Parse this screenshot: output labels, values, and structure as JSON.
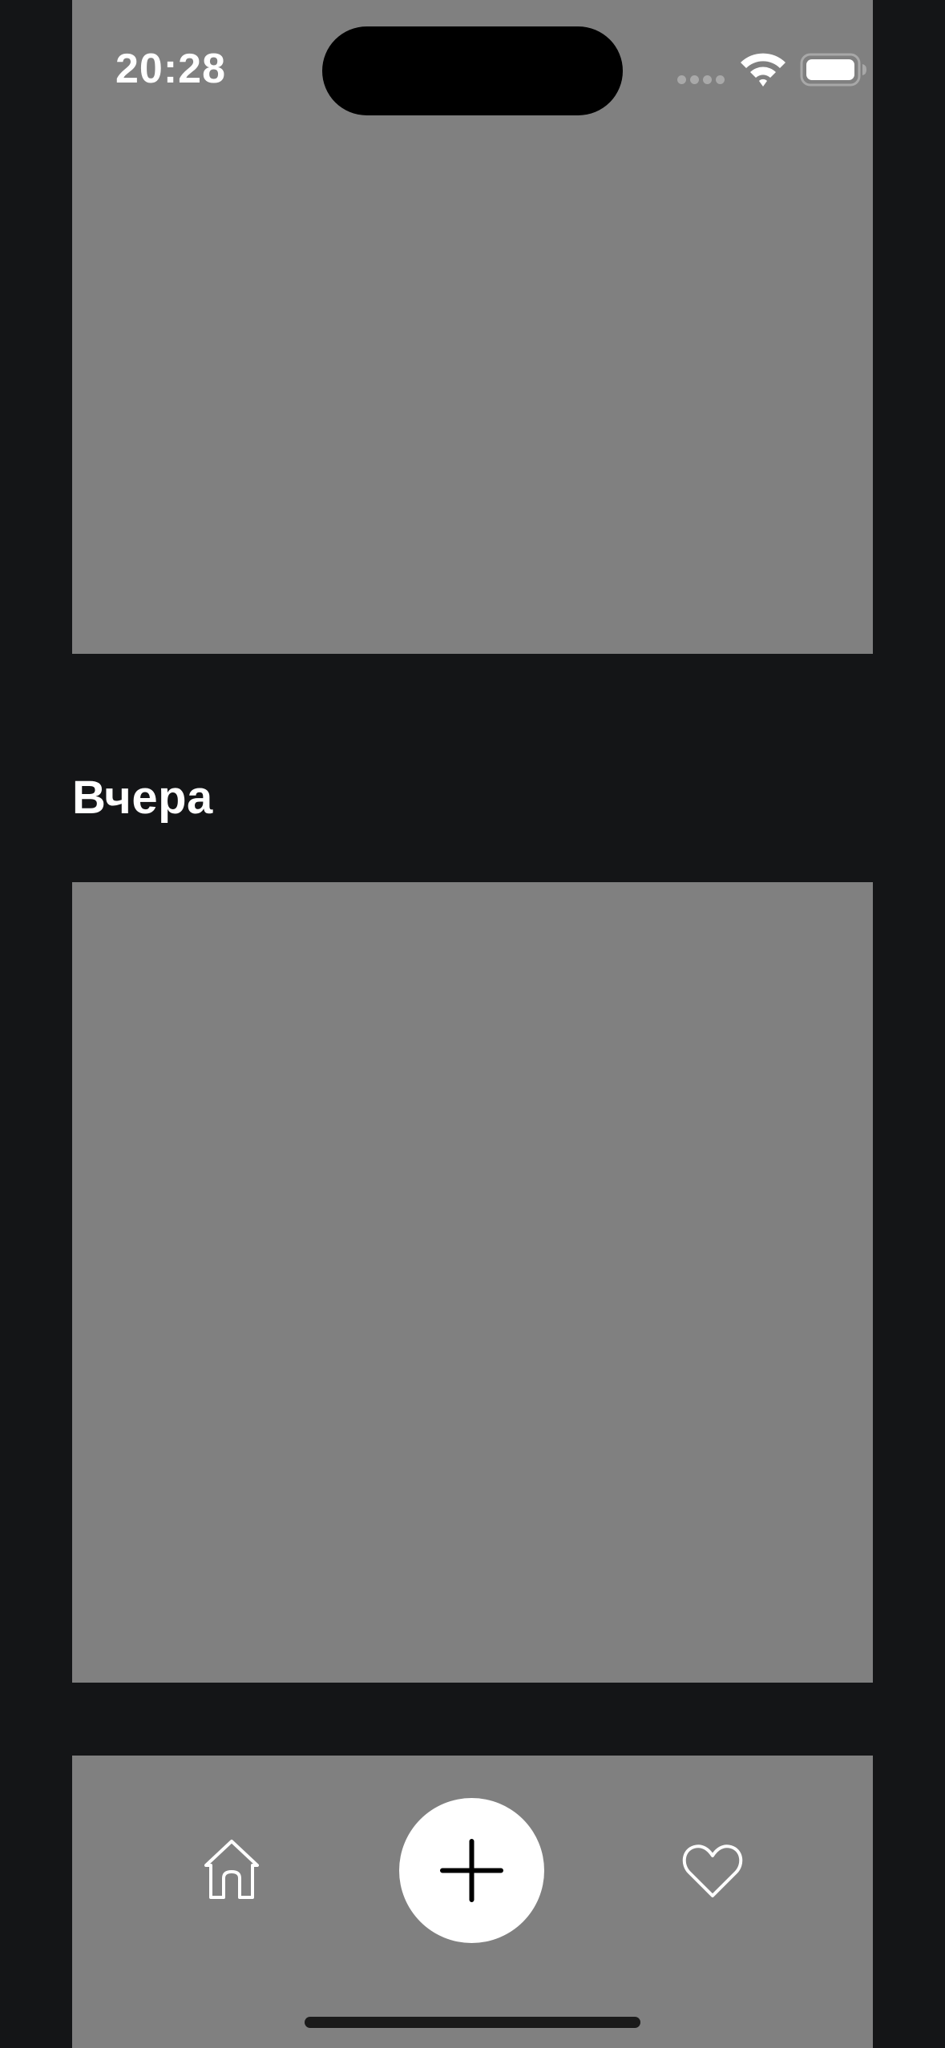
{
  "status_bar": {
    "time": "20:28",
    "signal_icon": "cellular-signal-icon",
    "wifi_icon": "wifi-icon",
    "battery_icon": "battery-icon"
  },
  "feed": {
    "section_title": "Вчера"
  },
  "tab_bar": {
    "items": [
      {
        "icon": "home-icon"
      },
      {
        "icon": "plus-icon"
      },
      {
        "icon": "heart-icon"
      }
    ]
  },
  "colors": {
    "background": "#141517",
    "photo_placeholder": "#808080",
    "text": "#ffffff",
    "add_button": "#ffffff"
  }
}
